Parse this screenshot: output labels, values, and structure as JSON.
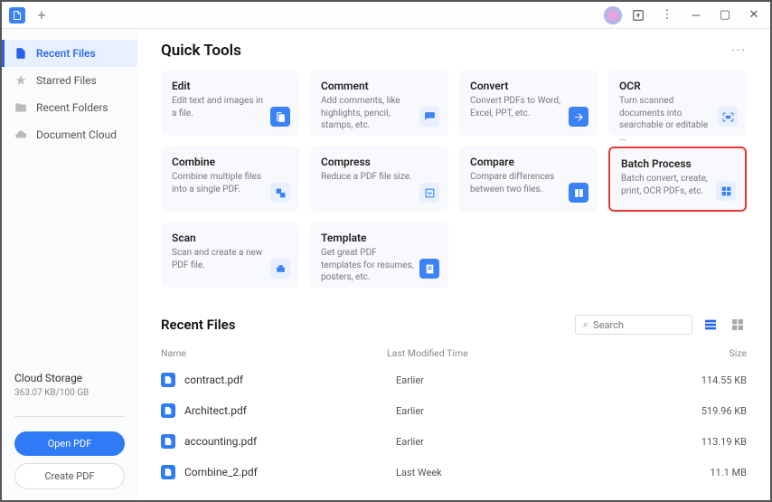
{
  "sidebar": {
    "items": [
      {
        "label": "Recent Files",
        "icon": "doc"
      },
      {
        "label": "Starred Files",
        "icon": "star"
      },
      {
        "label": "Recent Folders",
        "icon": "folder"
      },
      {
        "label": "Document Cloud",
        "icon": "cloud"
      }
    ],
    "cloud_label": "Cloud Storage",
    "cloud_usage": "363.07 KB/100 GB",
    "open_btn": "Open PDF",
    "create_btn": "Create PDF"
  },
  "quick_tools": {
    "title": "Quick Tools",
    "cards": [
      {
        "title": "Edit",
        "desc": "Edit text and images in a file."
      },
      {
        "title": "Comment",
        "desc": "Add comments, like highlights, pencil, stamps, etc."
      },
      {
        "title": "Convert",
        "desc": "Convert PDFs to Word, Excel, PPT, etc."
      },
      {
        "title": "OCR",
        "desc": "Turn scanned documents into searchable or editable ..."
      },
      {
        "title": "Combine",
        "desc": "Combine multiple files into a single PDF."
      },
      {
        "title": "Compress",
        "desc": "Reduce a PDF file size."
      },
      {
        "title": "Compare",
        "desc": "Compare differences between two files."
      },
      {
        "title": "Batch Process",
        "desc": "Batch convert, create, print, OCR PDFs, etc."
      },
      {
        "title": "Scan",
        "desc": "Scan and create a new PDF file."
      },
      {
        "title": "Template",
        "desc": "Get great PDF templates for resumes, posters, etc."
      }
    ]
  },
  "recent": {
    "title": "Recent Files",
    "search_placeholder": "Search",
    "headers": {
      "name": "Name",
      "time": "Last Modified Time",
      "size": "Size"
    },
    "files": [
      {
        "name": "contract.pdf",
        "time": "Earlier",
        "size": "114.55 KB"
      },
      {
        "name": "Architect.pdf",
        "time": "Earlier",
        "size": "519.96 KB"
      },
      {
        "name": "accounting.pdf",
        "time": "Earlier",
        "size": "113.19 KB"
      },
      {
        "name": "Combine_2.pdf",
        "time": "Last Week",
        "size": "11.1 MB"
      }
    ]
  }
}
